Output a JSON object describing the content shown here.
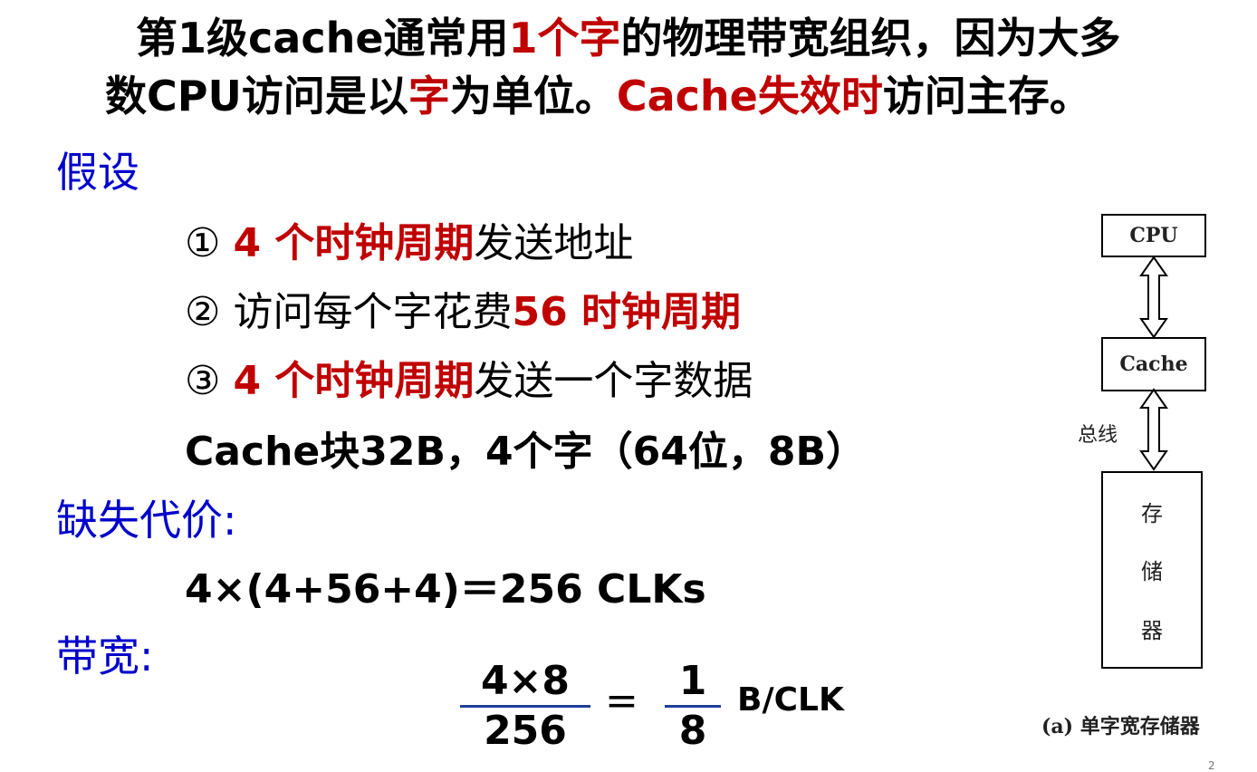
{
  "intro": {
    "line1": [
      {
        "t": "第1级cache通常用",
        "red": false
      },
      {
        "t": "1个字",
        "red": true
      },
      {
        "t": "的物理带宽组织，因为大多",
        "red": false
      }
    ],
    "line2": [
      {
        "t": "数CPU访问是以",
        "red": false
      },
      {
        "t": "字",
        "red": true
      },
      {
        "t": "为单位。",
        "red": false
      },
      {
        "t": "Cache失效时",
        "red": true
      },
      {
        "t": "访问主存。",
        "red": false
      }
    ]
  },
  "assume": {
    "heading": "假设",
    "item1": {
      "mark": "①",
      "red": "4 个时钟周期",
      "rest": "发送地址"
    },
    "item2": {
      "mark": "②",
      "rest": "访问每个字花费",
      "red": "56 时钟周期"
    },
    "item3": {
      "mark": "③",
      "red": "4 个时钟周期",
      "rest": "发送一个字数据"
    },
    "block": "Cache块32B，4个字（64位，8B）"
  },
  "miss": {
    "heading": "缺失代价:",
    "formula": "4×(4+56+4)＝256 CLKs"
  },
  "bandwidth": {
    "heading": "带宽:",
    "frac1_num": "4×8",
    "frac1_den": "256",
    "equals": "=",
    "frac2_num": "1",
    "frac2_den": "8",
    "unit": "B/CLK"
  },
  "diagram": {
    "cpu": "CPU",
    "cache": "Cache",
    "bus": "总线",
    "memory_chars": [
      "存",
      "储",
      "器"
    ],
    "caption": "(a) 单字宽存储器"
  },
  "page_number": "2"
}
